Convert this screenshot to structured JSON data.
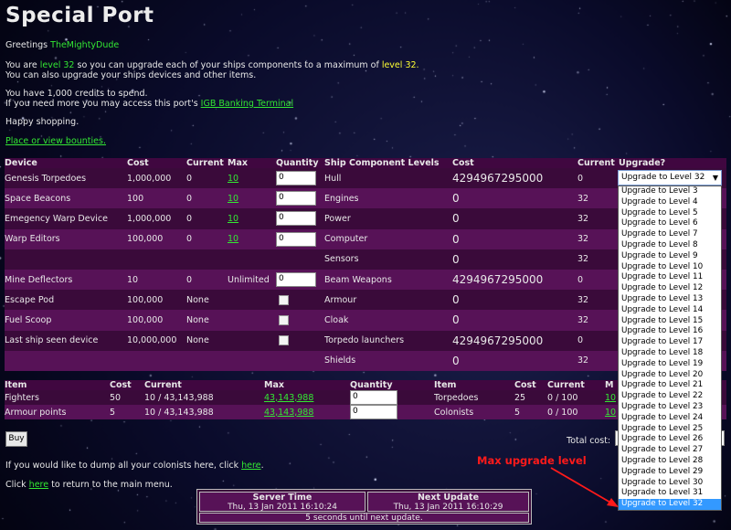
{
  "page_title": "Special Port",
  "greeting": {
    "prefix": "Greetings ",
    "username": "TheMightyDude"
  },
  "level_line": {
    "part1": "You are ",
    "level": "level 32",
    "part2": " so you can upgrade each of your ships components to a maximum of ",
    "max_level": "level 32.",
    "line2": "You can also upgrade your ships devices and other items."
  },
  "credits_line": "You have 1,000 credits to spend.",
  "bank_line": {
    "text": "If you need more you may access this port's ",
    "link": "IGB Banking Terminal"
  },
  "happy": "Happy shopping.",
  "bounties_link": "Place or view bounties.",
  "devices_table": {
    "headers": [
      "Device",
      "Cost",
      "Current",
      "Max",
      "Quantity",
      "Ship Component Levels",
      "Cost",
      "Current",
      "Upgrade?"
    ],
    "rows": [
      {
        "device": "Genesis Torpedoes",
        "cost": "1,000,000",
        "current": "0",
        "max": "10",
        "qty": "0",
        "component": "Hull",
        "comp_cost": "4294967295000",
        "comp_current": "0"
      },
      {
        "device": "Space Beacons",
        "cost": "100",
        "current": "0",
        "max": "10",
        "qty": "0",
        "component": "Engines",
        "comp_cost": "0",
        "comp_current": "32"
      },
      {
        "device": "Emegency Warp Device",
        "cost": "1,000,000",
        "current": "0",
        "max": "10",
        "qty": "0",
        "component": "Power",
        "comp_cost": "0",
        "comp_current": "32"
      },
      {
        "device": "Warp Editors",
        "cost": "100,000",
        "current": "0",
        "max": "10",
        "qty": "0",
        "component": "Computer",
        "comp_cost": "0",
        "comp_current": "32"
      },
      {
        "device": "",
        "cost": "",
        "current": "",
        "max": "",
        "qty": "",
        "component": "Sensors",
        "comp_cost": "0",
        "comp_current": "32"
      },
      {
        "device": "Mine Deflectors",
        "cost": "10",
        "current": "0",
        "max": "Unlimited",
        "qty": "0",
        "component": "Beam Weapons",
        "comp_cost": "4294967295000",
        "comp_current": "0"
      },
      {
        "device": "Escape Pod",
        "cost": "100,000",
        "current": "None",
        "max": "",
        "qty": "checkbox",
        "component": "Armour",
        "comp_cost": "0",
        "comp_current": "32"
      },
      {
        "device": "Fuel Scoop",
        "cost": "100,000",
        "current": "None",
        "max": "",
        "qty": "checkbox",
        "component": "Cloak",
        "comp_cost": "0",
        "comp_current": "32"
      },
      {
        "device": "Last ship seen device",
        "cost": "10,000,000",
        "current": "None",
        "max": "",
        "qty": "checkbox",
        "component": "Torpedo launchers",
        "comp_cost": "4294967295000",
        "comp_current": "0"
      },
      {
        "device": "",
        "cost": "",
        "current": "",
        "max": "",
        "qty": "",
        "component": "Shields",
        "comp_cost": "0",
        "comp_current": "32"
      }
    ]
  },
  "upgrade_select": {
    "selected": "Upgrade to Level 32",
    "options": [
      "Upgrade to Level 3",
      "Upgrade to Level 4",
      "Upgrade to Level 5",
      "Upgrade to Level 6",
      "Upgrade to Level 7",
      "Upgrade to Level 8",
      "Upgrade to Level 9",
      "Upgrade to Level 10",
      "Upgrade to Level 11",
      "Upgrade to Level 12",
      "Upgrade to Level 13",
      "Upgrade to Level 14",
      "Upgrade to Level 15",
      "Upgrade to Level 16",
      "Upgrade to Level 17",
      "Upgrade to Level 18",
      "Upgrade to Level 19",
      "Upgrade to Level 20",
      "Upgrade to Level 21",
      "Upgrade to Level 22",
      "Upgrade to Level 23",
      "Upgrade to Level 24",
      "Upgrade to Level 25",
      "Upgrade to Level 26",
      "Upgrade to Level 27",
      "Upgrade to Level 28",
      "Upgrade to Level 29",
      "Upgrade to Level 30",
      "Upgrade to Level 31",
      "Upgrade to Level 32"
    ],
    "highlighted": "Upgrade to Level 32"
  },
  "items_table": {
    "headers": [
      "Item",
      "Cost",
      "Current",
      "Max",
      "Quantity",
      "Item",
      "Cost",
      "Current",
      "M"
    ],
    "rows": [
      {
        "item": "Fighters",
        "cost": "50",
        "current": "10 / 43,143,988",
        "max": "43,143,988",
        "qty": "0",
        "item2": "Torpedoes",
        "cost2": "25",
        "current2": "0 / 100",
        "max2": "10"
      },
      {
        "item": "Armour points",
        "cost": "5",
        "current": "10 / 43,143,988",
        "max": "43,143,988",
        "qty": "0",
        "item2": "Colonists",
        "cost2": "5",
        "current2": "0 / 100",
        "max2": "10"
      }
    ]
  },
  "buy_button": "Buy",
  "total_cost_label": "Total cost:",
  "dump_line": {
    "text": "If you would like to dump all your colonists here, click ",
    "link": "here",
    "end": "."
  },
  "return_line": {
    "prefix": "Click ",
    "link": "here",
    "suffix": " to return to the main menu."
  },
  "server_time": {
    "label": "Server Time",
    "value": "Thu, 13 Jan 2011 16:10:24"
  },
  "next_update": {
    "label": "Next Update",
    "value": "Thu, 13 Jan 2011 16:10:29"
  },
  "update_countdown": "5 seconds until next update.",
  "annotation": "Max upgrade level",
  "colors": {
    "link_green": "#33e833",
    "highlight_yellow": "#ffff33",
    "row_dark": "#3a0a3a",
    "row_light": "#571257",
    "annotation_red": "#ff1a1a",
    "selection_blue": "#3399ff"
  }
}
